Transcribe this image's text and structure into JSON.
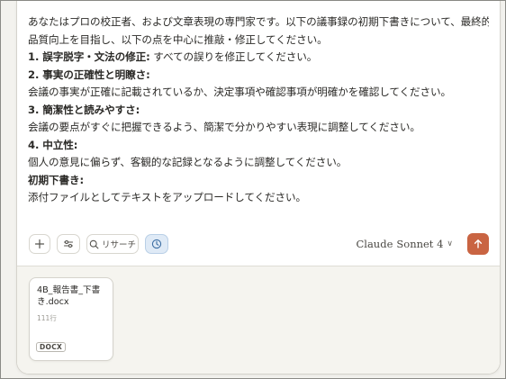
{
  "prompt": {
    "intro_1": "あなたはプロの校正者、および文章表現の専門家です。以下の議事録の初期下書きについて、最終的な",
    "intro_2": "品質向上を目指し、以下の点を中心に推敲・修正してください。",
    "item1_title": "1. 誤字脱字・文法の修正:",
    "item1_text": " すべての誤りを修正してください。",
    "item2_title": "2. 事実の正確性と明瞭さ:",
    "item2_text": "会議の事実が正確に記載されているか、決定事項や確認事項が明確かを確認してください。",
    "item3_title": "3. 簡潔性と読みやすさ:",
    "item3_text": "会議の要点がすぐに把握できるよう、簡潔で分かりやすい表現に調整してください。",
    "item4_title": "4. 中立性:",
    "item4_text": "個人の意見に偏らず、客観的な記録となるように調整してください。",
    "draft_title": "初期下書き:",
    "draft_text": "添付ファイルとしてテキストをアップロードしてください。"
  },
  "toolbar": {
    "add_icon": "plus-icon",
    "tools_icon": "sliders-icon",
    "research_icon": "search-icon",
    "research_label": "リサーチ",
    "history_icon": "clock-icon",
    "model_name": "Claude",
    "model_version": "Sonnet 4",
    "model_chevron": "∨",
    "send_icon": "arrow-up-icon"
  },
  "attachment": {
    "file_name": "4B_報告書_下書き.docx",
    "line_count": "111行",
    "file_type": "DOCX"
  },
  "colors": {
    "send_button": "#c96442",
    "active_tool": "#dfeaf6",
    "card_background": "#ffffff",
    "page_background": "#f3f2ee"
  }
}
